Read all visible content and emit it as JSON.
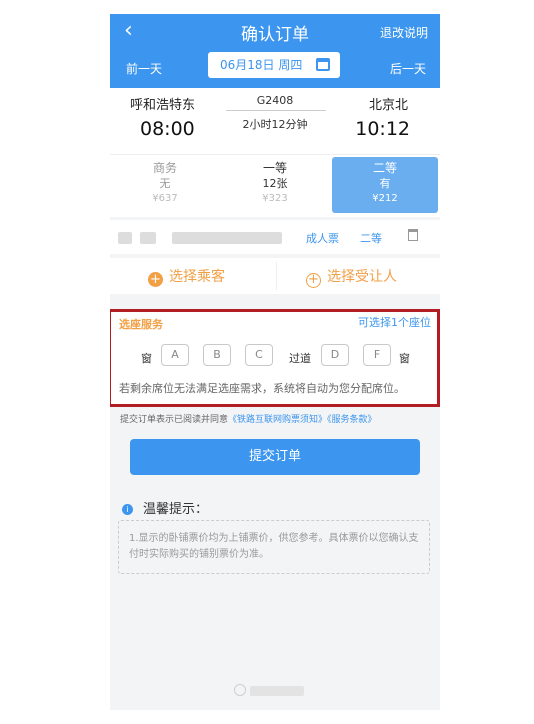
{
  "header": {
    "back_icon": "back-arrow",
    "title": "确认订单",
    "refund_label": "退改说明",
    "prev_day": "前一天",
    "next_day": "后一天",
    "date": "06月18日 周四"
  },
  "train": {
    "from": "呼和浩特东",
    "to": "北京北",
    "number": "G2408",
    "duration": "2小时12分钟",
    "depart_time": "08:00",
    "arrive_time": "10:12"
  },
  "classes": [
    {
      "name": "商务",
      "availability": "无",
      "price": "¥637"
    },
    {
      "name": "一等",
      "availability": "12张",
      "price": "¥323"
    },
    {
      "name": "二等",
      "availability": "有",
      "price": "¥212"
    }
  ],
  "passenger": {
    "ticket_type": "成人票",
    "seat_class": "二等"
  },
  "actions": {
    "select_passenger": "选择乘客",
    "select_beneficiary": "选择受让人"
  },
  "seat_selection": {
    "title": "选座服务",
    "available": "可选择1个座位",
    "window_left": "窗",
    "window_right": "窗",
    "aisle": "过道",
    "seats": [
      "A",
      "B",
      "C",
      "D",
      "F"
    ],
    "note": "若剩余席位无法满足选座需求，系统将自动为您分配席位。"
  },
  "agreement": {
    "prefix": "提交订单表示已阅读并同意",
    "link1": "《铁路互联网购票须知》",
    "link2": "《服务条款》"
  },
  "submit_label": "提交订单",
  "tips": {
    "title": "温馨提示：",
    "text": "1.显示的卧铺票价均为上铺票价，供您参考。具体票价以您确认支付时实际购买的铺别票价为准。"
  },
  "colors": {
    "brand_blue": "#3c95ee",
    "accent_orange": "#f2a046",
    "highlight_red": "#b21d24"
  }
}
